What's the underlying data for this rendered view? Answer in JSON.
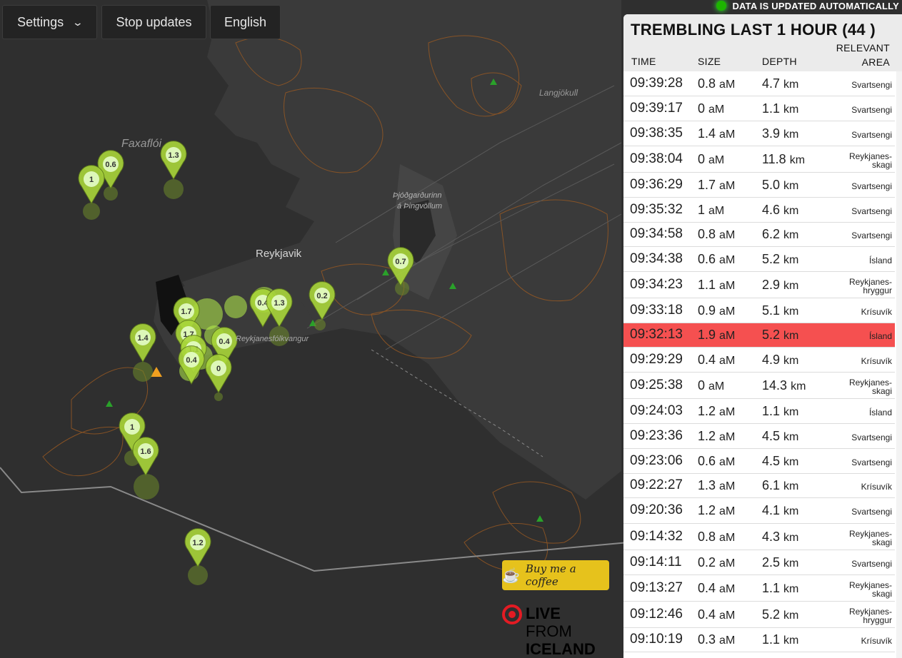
{
  "toolbar": {
    "settings_label": "Settings",
    "settings_icon": "chevron-down-icon",
    "stop_label": "Stop updates",
    "language_label": "English"
  },
  "status": {
    "text": "DATA IS UPDATED AUTOMATICALLY",
    "indicator_color": "#1db500"
  },
  "map": {
    "labels": {
      "faxafloi": "Faxaflói",
      "langjokull": "Langjökull",
      "reykjavik": "Reykjavik",
      "park_line1": "Þjóðgarðurinn",
      "park_line2": "á Þingvöllum",
      "reykjanes": "Reykjanesfólkvangur"
    },
    "markers": [
      "0.6",
      "1.3",
      "1",
      "0.7",
      "0.2",
      "1.7",
      "0.4",
      "1.3",
      "1.4",
      "1.7",
      "1.1",
      "0.4",
      "0.4",
      "0",
      "1",
      "1.6",
      "1.2"
    ],
    "marker_color": "#a9d63a"
  },
  "panel": {
    "title": "TREMBLING LAST 1 HOUR (44 )",
    "columns": {
      "time": "TIME",
      "size": "SIZE",
      "depth": "DEPTH",
      "area_line1": "RELEVANT",
      "area_line2": "AREA"
    },
    "highlight_color": "#f55050",
    "rows": [
      {
        "time": "09:39:28",
        "size": "0.8",
        "unit": "aM",
        "depth": "4.7",
        "depth_unit": "km",
        "area": [
          "Svartsengi"
        ]
      },
      {
        "time": "09:39:17",
        "size": "0",
        "unit": "aM",
        "depth": "1.1",
        "depth_unit": "km",
        "area": [
          "Svartsengi"
        ]
      },
      {
        "time": "09:38:35",
        "size": "1.4",
        "unit": "aM",
        "depth": "3.9",
        "depth_unit": "km",
        "area": [
          "Svartsengi"
        ]
      },
      {
        "time": "09:38:04",
        "size": "0",
        "unit": "aM",
        "depth": "11.8",
        "depth_unit": "km",
        "area": [
          "Reykjanes-",
          "skagi"
        ]
      },
      {
        "time": "09:36:29",
        "size": "1.7",
        "unit": "aM",
        "depth": "5.0",
        "depth_unit": "km",
        "area": [
          "Svartsengi"
        ]
      },
      {
        "time": "09:35:32",
        "size": "1",
        "unit": "aM",
        "depth": "4.6",
        "depth_unit": "km",
        "area": [
          "Svartsengi"
        ]
      },
      {
        "time": "09:34:58",
        "size": "0.8",
        "unit": "aM",
        "depth": "6.2",
        "depth_unit": "km",
        "area": [
          "Svartsengi"
        ]
      },
      {
        "time": "09:34:38",
        "size": "0.6",
        "unit": "aM",
        "depth": "5.2",
        "depth_unit": "km",
        "area": [
          "Ísland"
        ]
      },
      {
        "time": "09:34:23",
        "size": "1.1",
        "unit": "aM",
        "depth": "2.9",
        "depth_unit": "km",
        "area": [
          "Reykjanes-",
          "hryggur"
        ]
      },
      {
        "time": "09:33:18",
        "size": "0.9",
        "unit": "aM",
        "depth": "5.1",
        "depth_unit": "km",
        "area": [
          "Krísuvík"
        ]
      },
      {
        "time": "09:32:13",
        "size": "1.9",
        "unit": "aM",
        "depth": "5.2",
        "depth_unit": "km",
        "area": [
          "Ísland"
        ],
        "highlight": true
      },
      {
        "time": "09:29:29",
        "size": "0.4",
        "unit": "aM",
        "depth": "4.9",
        "depth_unit": "km",
        "area": [
          "Krísuvík"
        ]
      },
      {
        "time": "09:25:38",
        "size": "0",
        "unit": "aM",
        "depth": "14.3",
        "depth_unit": "km",
        "area": [
          "Reykjanes-",
          "skagi"
        ]
      },
      {
        "time": "09:24:03",
        "size": "1.2",
        "unit": "aM",
        "depth": "1.1",
        "depth_unit": "km",
        "area": [
          "Ísland"
        ]
      },
      {
        "time": "09:23:36",
        "size": "1.2",
        "unit": "aM",
        "depth": "4.5",
        "depth_unit": "km",
        "area": [
          "Svartsengi"
        ]
      },
      {
        "time": "09:23:06",
        "size": "0.6",
        "unit": "aM",
        "depth": "4.5",
        "depth_unit": "km",
        "area": [
          "Svartsengi"
        ]
      },
      {
        "time": "09:22:27",
        "size": "1.3",
        "unit": "aM",
        "depth": "6.1",
        "depth_unit": "km",
        "area": [
          "Krísuvík"
        ]
      },
      {
        "time": "09:20:36",
        "size": "1.2",
        "unit": "aM",
        "depth": "4.1",
        "depth_unit": "km",
        "area": [
          "Svartsengi"
        ]
      },
      {
        "time": "09:14:32",
        "size": "0.8",
        "unit": "aM",
        "depth": "4.3",
        "depth_unit": "km",
        "area": [
          "Reykjanes-",
          "skagi"
        ]
      },
      {
        "time": "09:14:11",
        "size": "0.2",
        "unit": "aM",
        "depth": "2.5",
        "depth_unit": "km",
        "area": [
          "Svartsengi"
        ]
      },
      {
        "time": "09:13:27",
        "size": "0.4",
        "unit": "aM",
        "depth": "1.1",
        "depth_unit": "km",
        "area": [
          "Reykjanes-",
          "skagi"
        ]
      },
      {
        "time": "09:12:46",
        "size": "0.4",
        "unit": "aM",
        "depth": "5.2",
        "depth_unit": "km",
        "area": [
          "Reykjanes-",
          "hryggur"
        ]
      },
      {
        "time": "09:10:19",
        "size": "0.3",
        "unit": "aM",
        "depth": "1.1",
        "depth_unit": "km",
        "area": [
          "Krísuvík"
        ]
      }
    ]
  },
  "coffee": {
    "label": "Buy me a coffee",
    "icon": "coffee-cup-icon",
    "color": "#e6c21c"
  },
  "logo": {
    "line1": "LIVE",
    "line2": "FROM",
    "line3": "ICELAND",
    "accent": "#e31b23"
  }
}
